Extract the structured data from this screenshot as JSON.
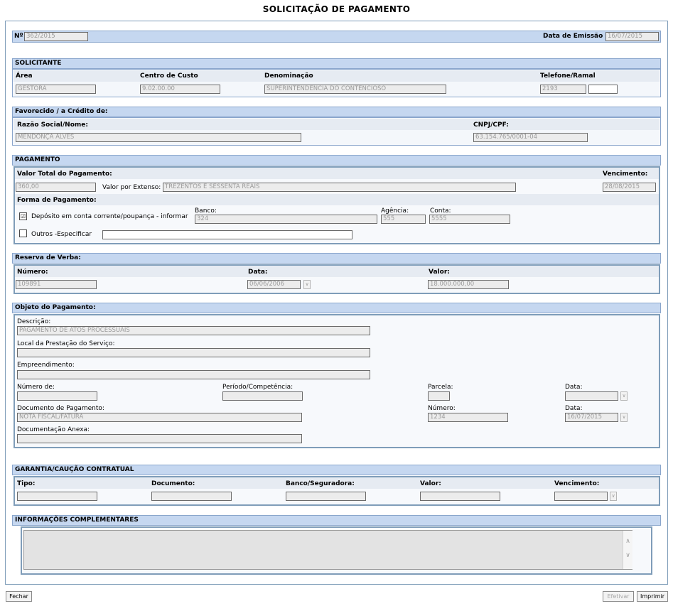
{
  "title": "SOLICITAÇÃO DE PAGAMENTO",
  "header": {
    "numero_label": "Nº",
    "numero_value": "362/2015",
    "emissao_label": "Data de Emissão",
    "emissao_value": "16/07/2015"
  },
  "solicitante": {
    "title": "SOLICITANTE",
    "area_label": "Área",
    "area_value": "GESTORA",
    "centro_label": "Centro de Custo",
    "centro_value": "9.02.00.00",
    "denominacao_label": "Denominação",
    "denominacao_value": "SUPERINTENDÊNCIA DO CONTENCIOSO",
    "telefone_label": "Telefone/Ramal",
    "telefone_value": "2193",
    "ramal_value": ""
  },
  "favorecido": {
    "title": "Favorecido / a Crédito de:",
    "razao_label": "Razão Social/Nome:",
    "razao_value": "MENDONÇA ALVES",
    "cnpj_label": "CNPJ/CPF:",
    "cnpj_value": "63.154.765/0001-04"
  },
  "pagamento": {
    "title": "PAGAMENTO",
    "valor_total_label": "Valor Total do Pagamento:",
    "valor_total_value": "360,00",
    "extenso_label": "Valor por Extenso:",
    "extenso_value": "TREZENTOS E SESSENTA REAIS",
    "vencimento_label": "Vencimento:",
    "vencimento_value": "28/08/2015",
    "forma_label": "Forma de Pagamento:",
    "deposito_label": "Depósito em conta corrente/poupança - informar",
    "deposito_checked": "☑",
    "banco_label": "Banco:",
    "banco_value": "324",
    "agencia_label": "Agência:",
    "agencia_value": "555",
    "conta_label": "Conta:",
    "conta_value": "5555",
    "outros_label": "Outros -Especificar",
    "outros_checked": "",
    "outros_value": ""
  },
  "reserva": {
    "title": "Reserva de Verba:",
    "numero_label": "Número:",
    "numero_value": "109891",
    "data_label": "Data:",
    "data_value": "06/06/2006",
    "valor_label": "Valor:",
    "valor_value": "18.000.000,00"
  },
  "objeto": {
    "title": "Objeto do Pagamento:",
    "descricao_label": "Descrição:",
    "descricao_value": "PAGAMENTO DE ATOS PROCESSUAIS",
    "local_label": "Local da Prestação do Serviço:",
    "local_value": "",
    "empreendimento_label": "Empreendimento:",
    "empreendimento_value": "",
    "numero_de_label": "Número de:",
    "numero_de_value": "",
    "periodo_label": "Período/Competência:",
    "periodo_value": "",
    "parcela_label": "Parcela:",
    "parcela_value": "",
    "data1_label": "Data:",
    "data1_value": "",
    "documento_label": "Documento de Pagamento:",
    "documento_value": "NOTA FISCAL/FATURA",
    "numero2_label": "Número:",
    "numero2_value": "1234",
    "data2_label": "Data:",
    "data2_value": "16/07/2015",
    "anexa_label": "Documentação Anexa:",
    "anexa_value": ""
  },
  "garantia": {
    "title": "GARANTIA/CAUÇÃO CONTRATUAL",
    "tipo_label": "Tipo:",
    "documento_label": "Documento:",
    "banco_label": "Banco/Seguradora:",
    "valor_label": "Valor:",
    "vencimento_label": "Vencimento:"
  },
  "informacoes": {
    "title": "INFORMAÇÕES COMPLEMENTARES",
    "value": ""
  },
  "footer": {
    "fechar": "Fechar",
    "efetivar": "Efetivar",
    "imprimir": "Imprimir"
  },
  "icons": {
    "dropdown": "∨",
    "scroll_up": "∧",
    "scroll_down": "∨"
  }
}
